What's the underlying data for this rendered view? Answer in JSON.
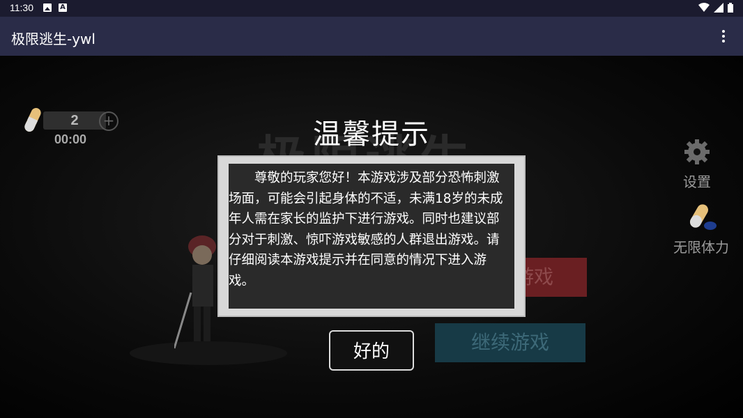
{
  "status_bar": {
    "time": "11:30"
  },
  "app_bar": {
    "title": "极限逃生-ywl"
  },
  "game": {
    "bg_title": "极限逃生",
    "hud": {
      "count": "2",
      "timer": "00:00"
    },
    "side": {
      "settings_label": "设置",
      "stamina_label": "无限体力"
    },
    "buttons": {
      "start_partial": "游戏",
      "continue": "继续游戏"
    }
  },
  "dialog": {
    "title": "温馨提示",
    "body": "尊敬的玩家您好！本游戏涉及部分恐怖刺激场面，可能会引起身体的不适，未满18岁的未成年人需在家长的监护下进行游戏。同时也建议部分对于刺激、惊吓游戏敏感的人群退出游戏。请仔细阅读本游戏提示并在同意的情况下进入游戏。",
    "ok_label": "好的"
  }
}
